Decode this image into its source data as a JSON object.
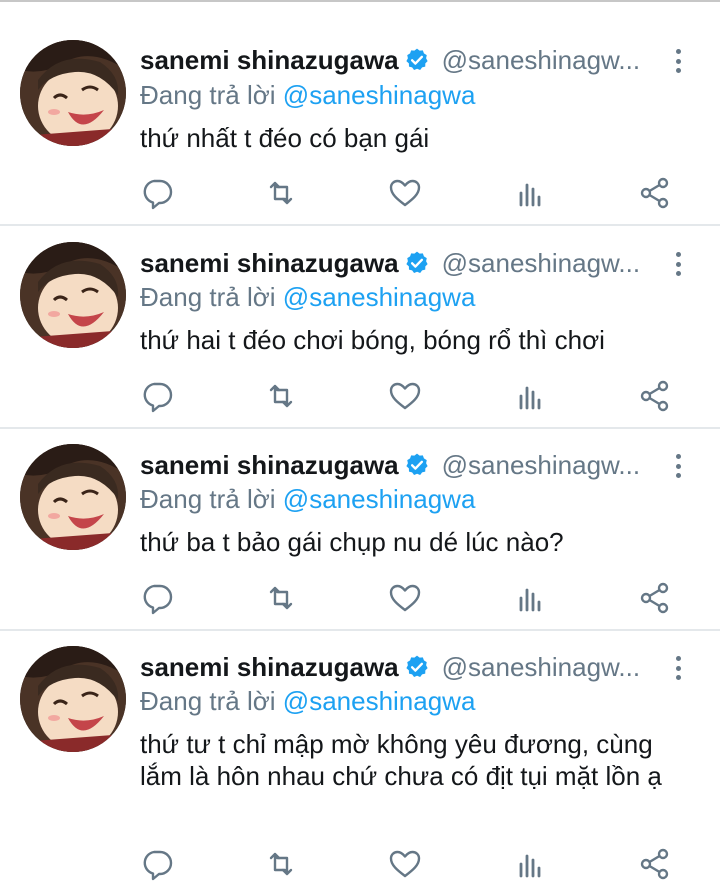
{
  "tweets": [
    {
      "name": "sanemi shinazugawa",
      "handle": "@saneshinagw...",
      "reply_prefix": "Đang trả lời",
      "reply_to": "@saneshinagwa",
      "text": "thứ nhất t đéo có bạn gái"
    },
    {
      "name": "sanemi shinazugawa",
      "handle": "@saneshinagw...",
      "reply_prefix": "Đang trả lời",
      "reply_to": "@saneshinagwa",
      "text": "thứ hai t đéo chơi bóng, bóng rổ thì chơi"
    },
    {
      "name": "sanemi shinazugawa",
      "handle": "@saneshinagw...",
      "reply_prefix": "Đang trả lời",
      "reply_to": "@saneshinagwa",
      "text": "thứ ba t bảo gái chụp nu dé lúc nào?"
    },
    {
      "name": "sanemi shinazugawa",
      "handle": "@saneshinagw...",
      "reply_prefix": "Đang trả lời",
      "reply_to": "@saneshinagwa",
      "text": "thứ tư t chỉ mập mờ không yêu đương, cùng lắm là hôn nhau chứ chưa có địt tụi mặt lồn ạ"
    }
  ],
  "colors": {
    "name_text": "#14171a",
    "secondary_text": "#657786",
    "accent_blue": "#1da1f2",
    "divider": "#e4e8eb",
    "icon_gray": "#657786"
  },
  "icons": {
    "verified": "verified-badge-icon",
    "more": "more-vertical-icon",
    "reply": "reply-icon",
    "retweet": "retweet-icon",
    "like": "heart-icon",
    "analytics": "analytics-icon",
    "share": "share-icon"
  }
}
